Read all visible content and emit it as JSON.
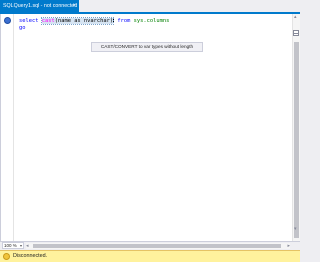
{
  "tab": {
    "title": "SQLQuery1.sql - not connected",
    "close_glyph": "×"
  },
  "editor": {
    "line1": {
      "kw_select": "select",
      "fn": "cast",
      "args": "(name as nvarchar)",
      "kw_from": "from",
      "object": "sys.columns"
    },
    "line2": {
      "kw_go": "go"
    }
  },
  "tooltip": {
    "text": "CAST/CONVERT to var types without length"
  },
  "zoom": {
    "value": "100 %"
  },
  "status": {
    "text": "Disconnected."
  },
  "icons": {
    "gutter_marker": "info-marker-icon",
    "status": "disconnected-icon",
    "split": "split-view-icon"
  },
  "colors": {
    "accent": "#007acc",
    "keyword": "#0000ff",
    "function": "#ff00ff",
    "object": "#008000",
    "status_bg": "#fff29d"
  }
}
